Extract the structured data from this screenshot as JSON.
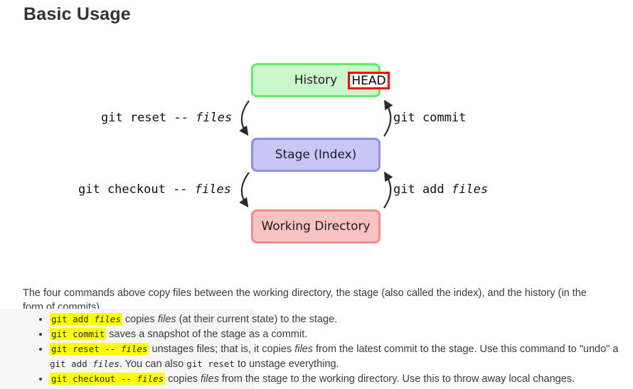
{
  "page": {
    "title": "Basic Usage"
  },
  "diagram": {
    "nodes": [
      {
        "id": "history",
        "label": "History",
        "fill": "#ccf7cc",
        "border": "#64ec64"
      },
      {
        "id": "stage",
        "label": "Stage (Index)",
        "fill": "#c7c7f7",
        "border": "#8f8fe8"
      },
      {
        "id": "working",
        "label": "Working Directory",
        "fill": "#f9c3c3",
        "border": "#ef8b8b"
      }
    ],
    "head_badge": {
      "label": "HEAD",
      "border_color": "#ff0000"
    },
    "edges": [
      {
        "id": "reset",
        "command": "git reset -- ",
        "argument": "files",
        "from": "history",
        "to": "stage",
        "side": "left"
      },
      {
        "id": "commit",
        "command": "git commit",
        "argument": "",
        "from": "stage",
        "to": "history",
        "side": "right"
      },
      {
        "id": "checkout",
        "command": "git checkout -- ",
        "argument": "files",
        "from": "stage",
        "to": "working",
        "side": "left"
      },
      {
        "id": "add",
        "command": "git add ",
        "argument": "files",
        "from": "working",
        "to": "stage",
        "side": "right"
      }
    ]
  },
  "body": {
    "intro": "The four commands above copy files between the working directory, the stage (also called the index), and the history (in the form of commits).",
    "bullets": [
      {
        "code": "git add ",
        "code_italic": "files",
        "text_1": " copies ",
        "em_1": "files",
        "text_2": " (at their current state) to the stage."
      },
      {
        "code": "git commit",
        "code_italic": "",
        "text_1": " saves a snapshot of the stage as a commit.",
        "em_1": "",
        "text_2": ""
      },
      {
        "code": "git reset -- ",
        "code_italic": "files",
        "text_1": " unstages files; that is, it copies ",
        "em_1": "files",
        "text_2": " from the latest commit to the stage. Use this command to \"undo\" a ",
        "inline_code_1": "git add ",
        "inline_code_1_italic": "files",
        "text_3": ". You can also ",
        "inline_code_2": "git reset",
        "text_4": " to unstage everything."
      },
      {
        "code": "git checkout -- ",
        "code_italic": "files",
        "text_1": " copies ",
        "em_1": "files",
        "text_2": " from the stage to the working directory. Use this to throw away local changes."
      }
    ]
  }
}
